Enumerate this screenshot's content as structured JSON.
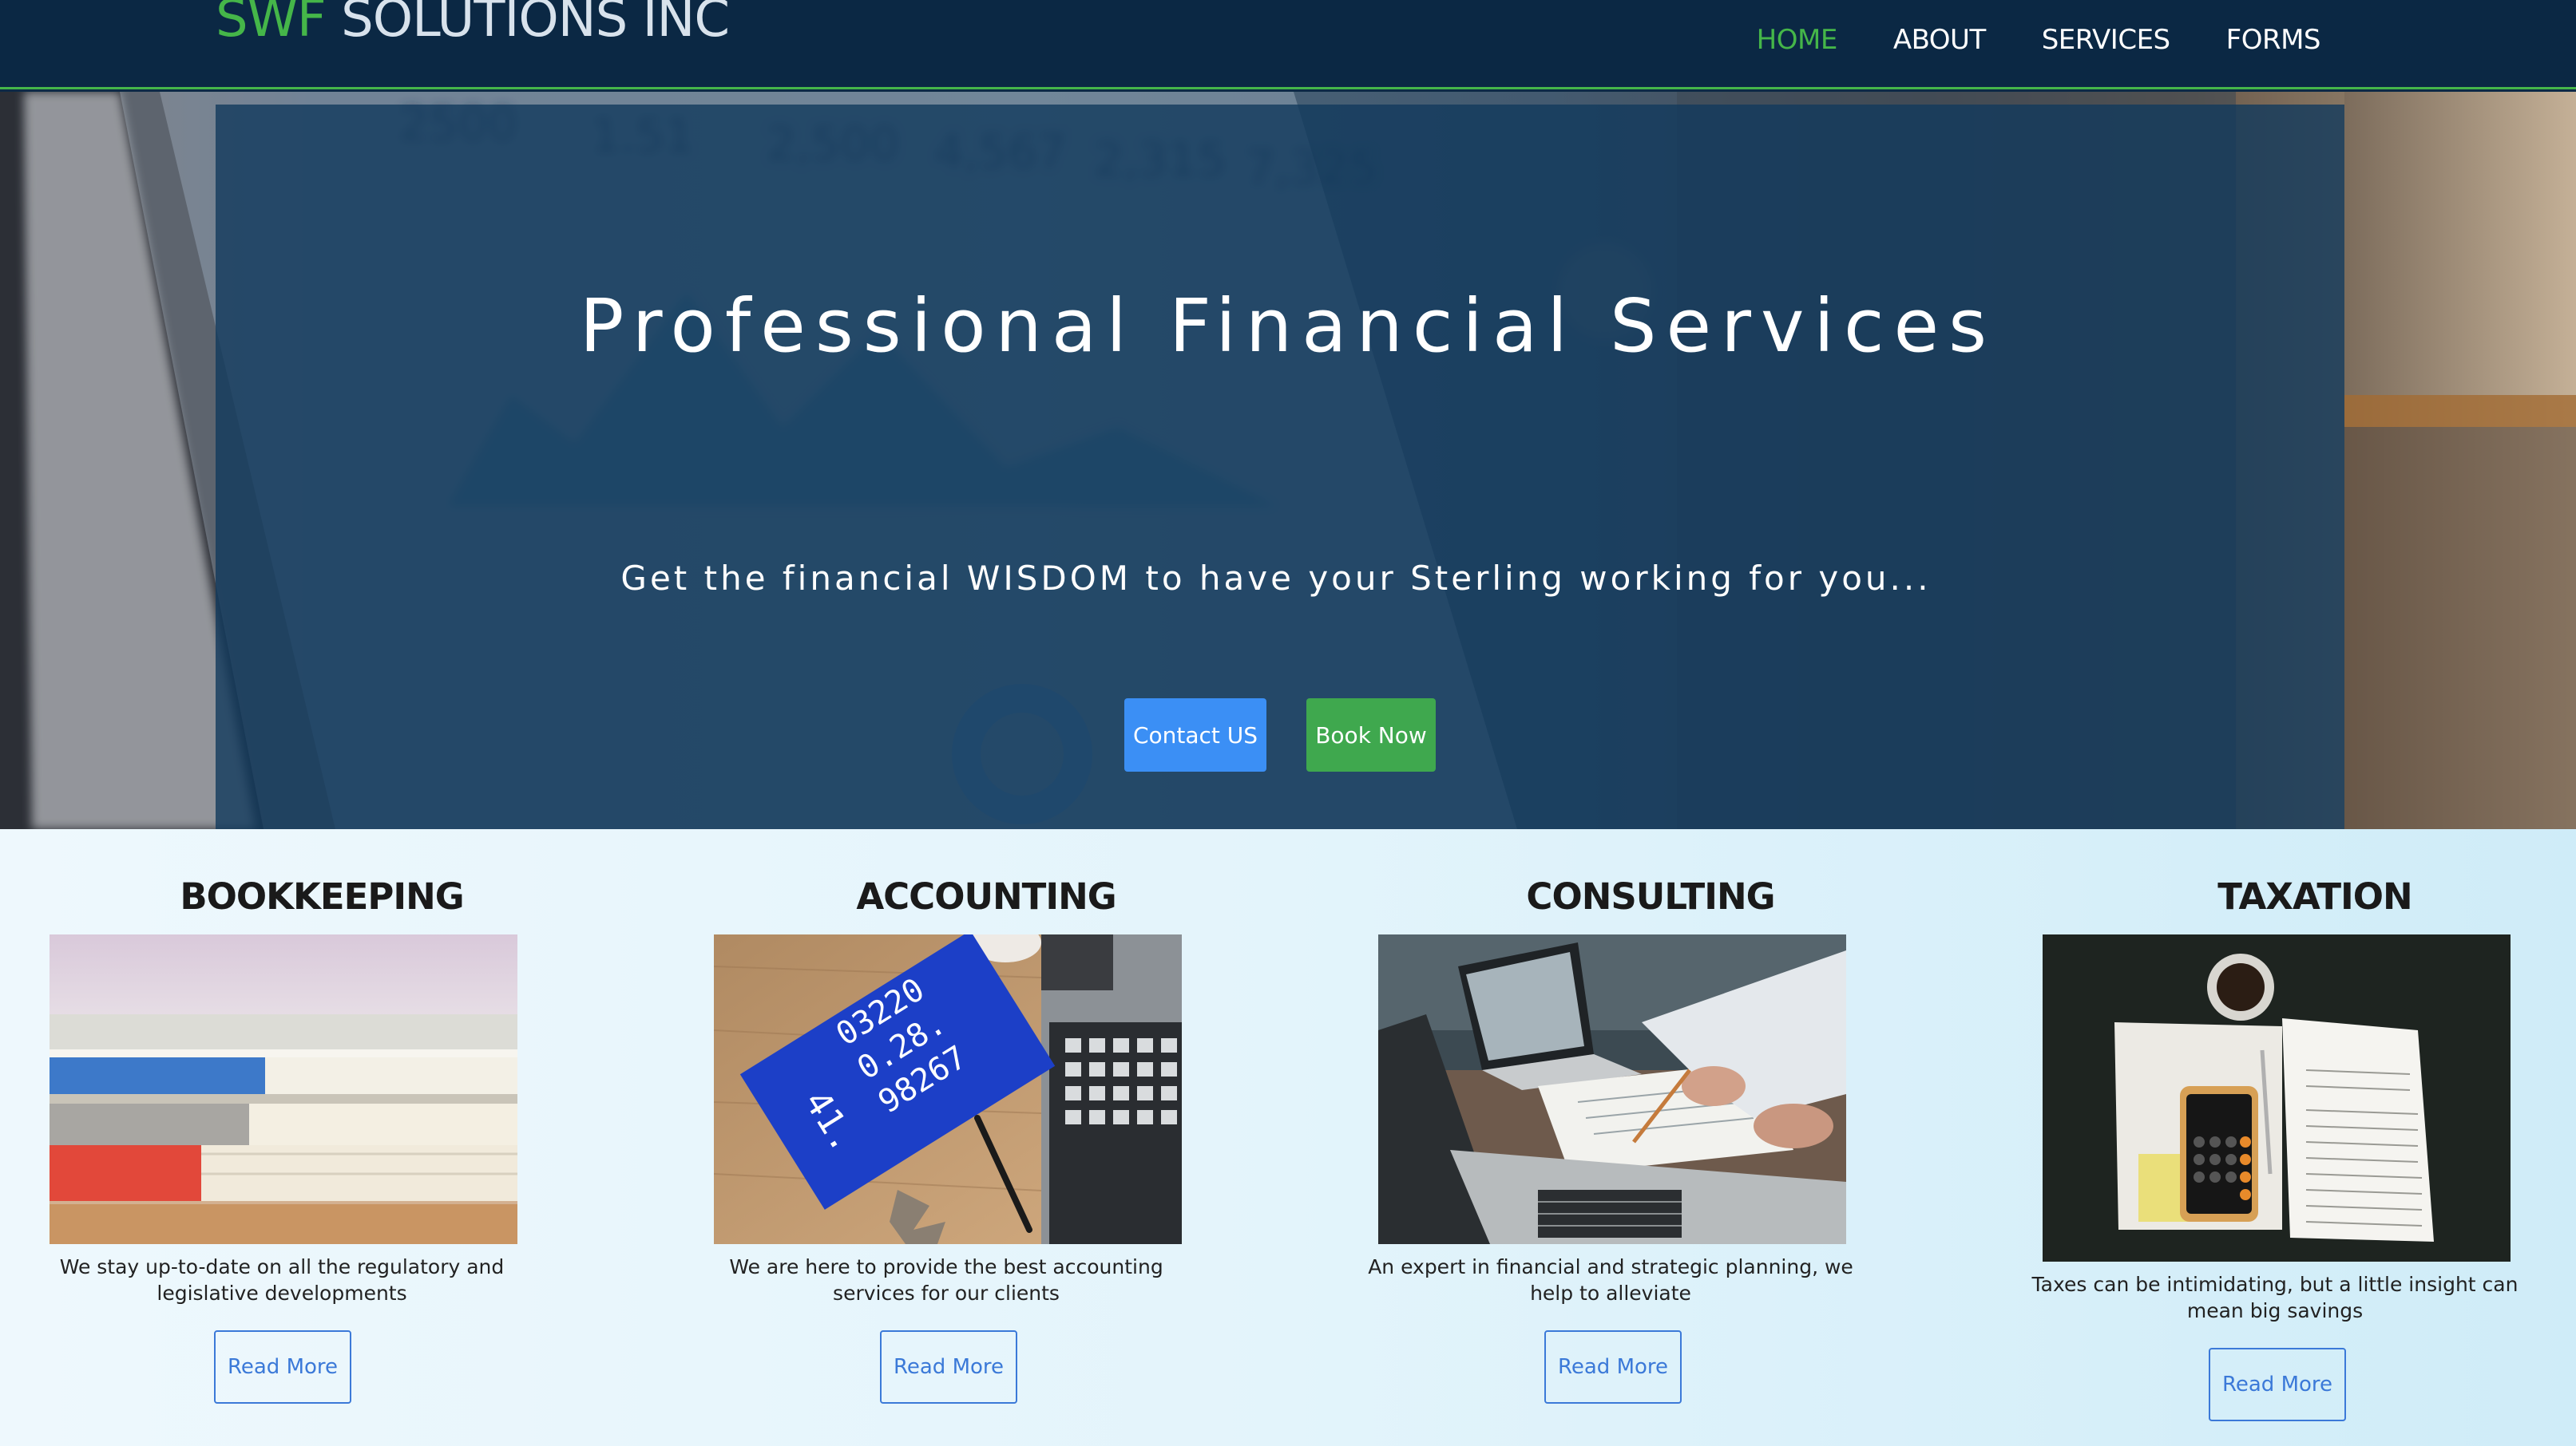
{
  "nav": {
    "brand_accent": "SWF",
    "brand_rest": " SOLUTIONS INC",
    "links": [
      "HOME",
      "ABOUT",
      "SERVICES",
      "FORMS"
    ],
    "active": "HOME"
  },
  "hero": {
    "title": "Professional Financial Services",
    "tagline": "Get the financial WISDOM to have your Sterling working for you...",
    "contact_label": "Contact US",
    "book_label": "Book Now"
  },
  "services": [
    {
      "title": "BOOKKEEPING",
      "text": "We stay up-to-date on all the regulatory and legislative developments",
      "button": "Read More"
    },
    {
      "title": "ACCOUNTING",
      "text": "We are here to provide the best accounting services for our clients",
      "button": "Read More"
    },
    {
      "title": "CONSULTING",
      "text": "An expert in financial and strategic planning, we help to alleviate",
      "button": "Read More"
    },
    {
      "title": "TAXATION",
      "text": "Taxes can be intimidating, but a little insight can mean big savings",
      "button": "Read More"
    }
  ],
  "colors": {
    "navbar_bg": "#0b2844",
    "accent_green": "#45b649",
    "button_blue": "#3b8ff5",
    "button_green": "#3fa84e",
    "link_blue": "#3b79d8"
  },
  "images": {
    "hero": "blurred-dashboard-laptop-photo",
    "bookkeeping": "stacked-books-photo",
    "accounting": "calculator-notebook-laptop-desk-photo",
    "consulting": "laptops-planning-paper-photo",
    "taxation": "tax-forms-phone-calculator-coffee-photo"
  }
}
